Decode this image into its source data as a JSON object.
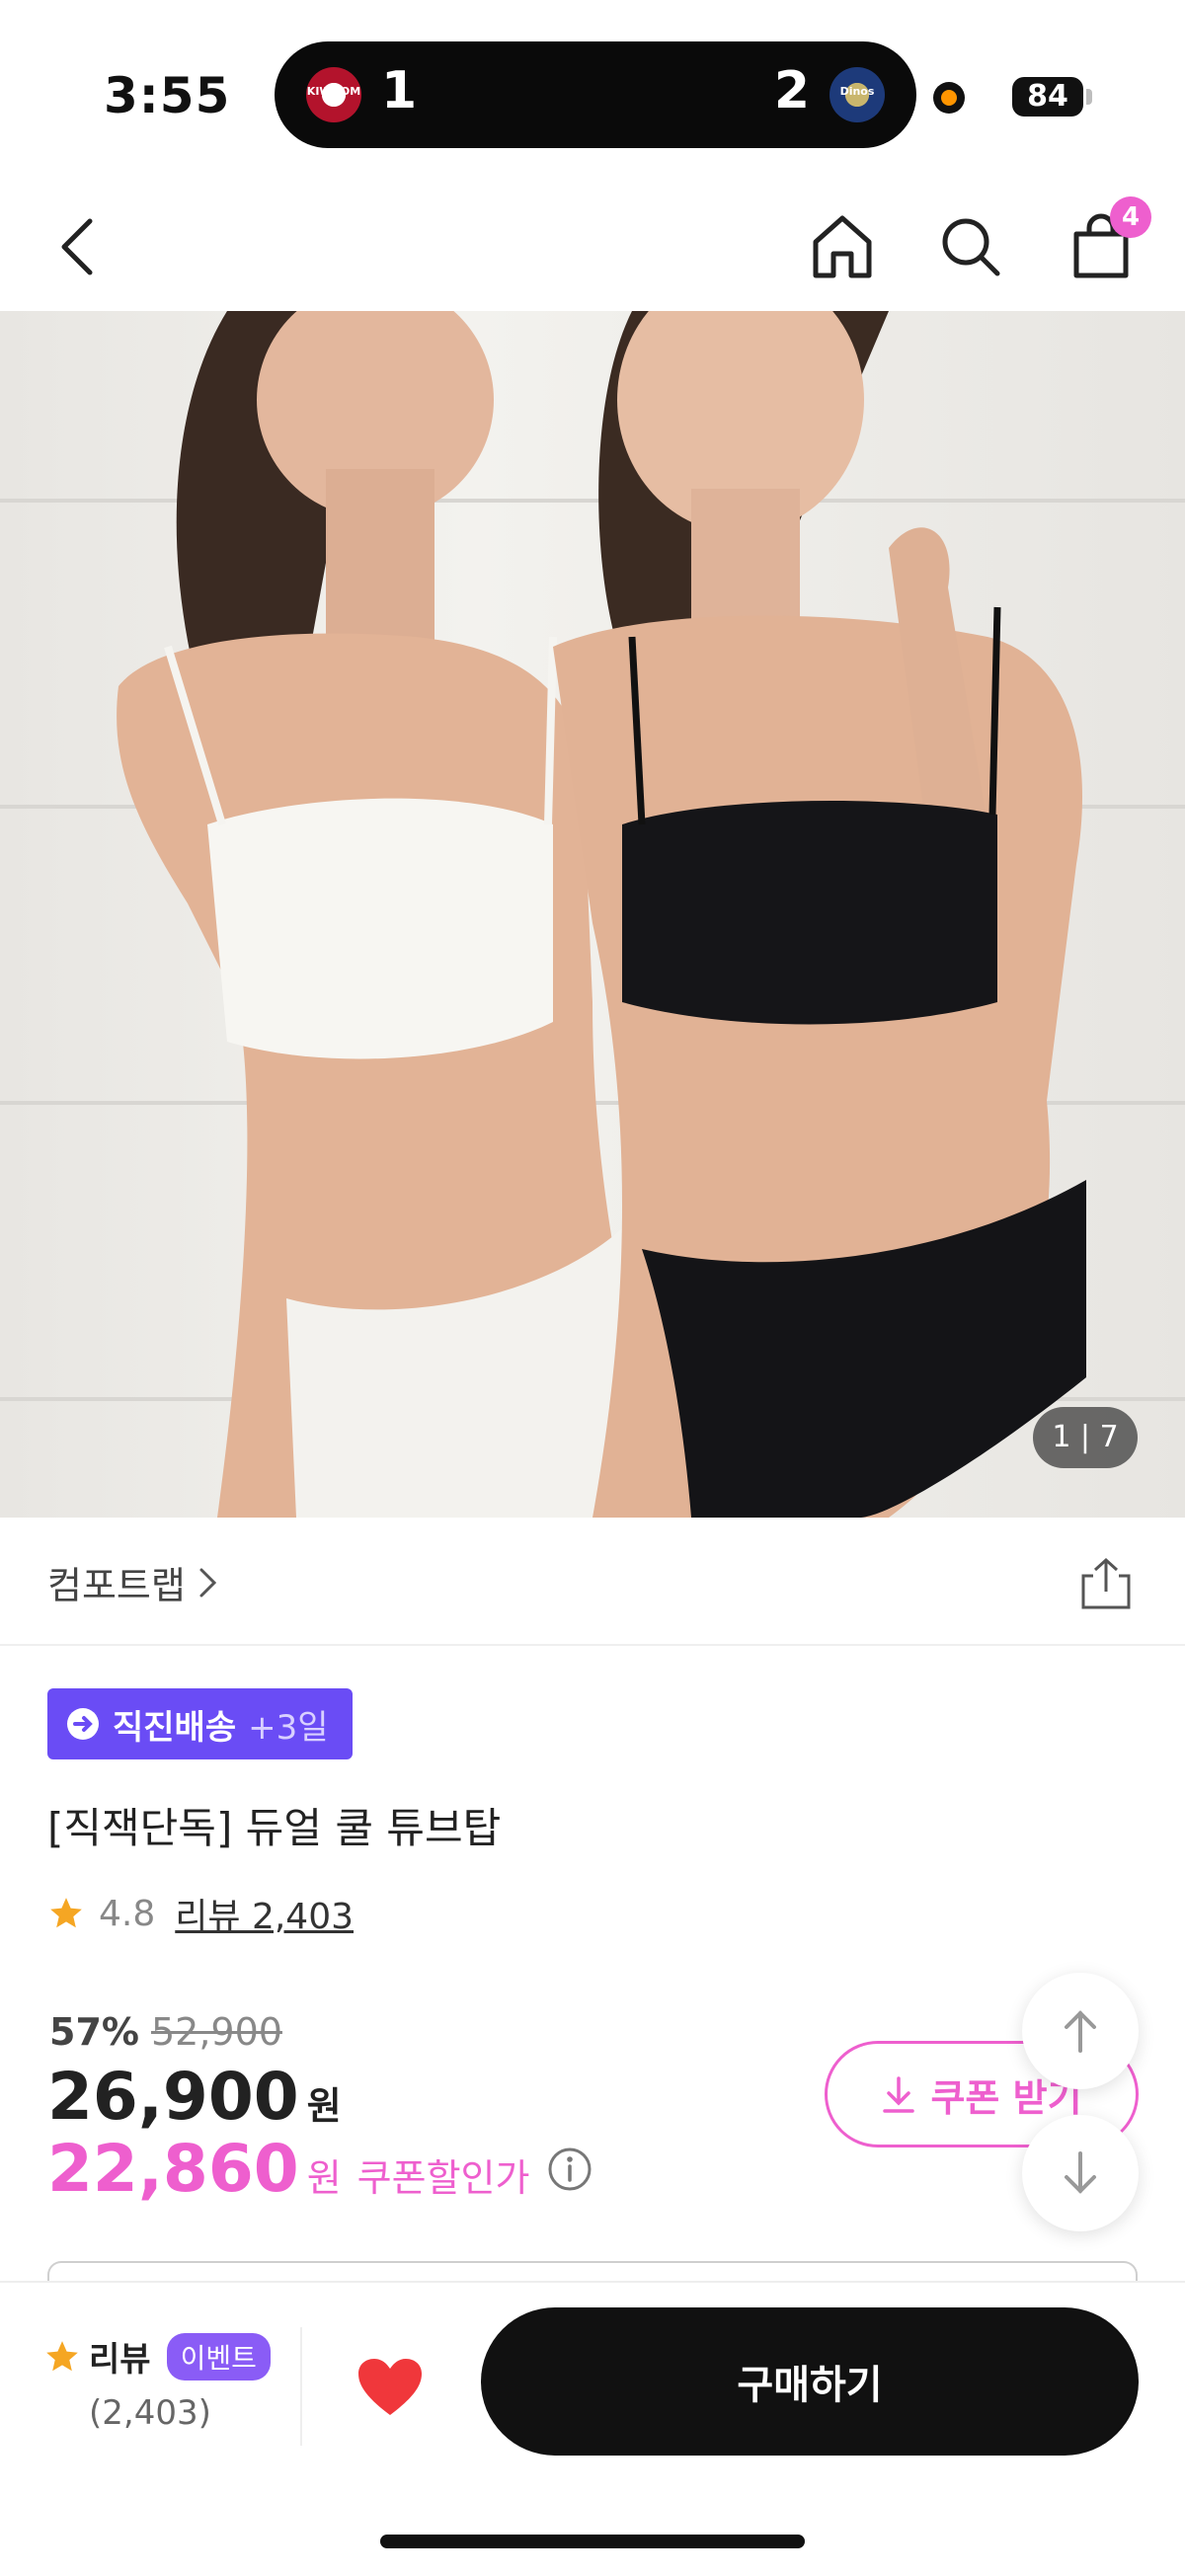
{
  "status_bar": {
    "time": "3:55",
    "home_team_logo_text": "KIWOOM",
    "home_score": "1",
    "away_score": "2",
    "away_team_logo_text": "Dinos",
    "battery": "84"
  },
  "top_nav": {
    "cart_count": "4",
    "icons": [
      "back-arrow-icon",
      "home-icon",
      "search-icon",
      "shopping-bag-icon"
    ]
  },
  "hero": {
    "page_indicator": "1 | 7",
    "current_page": 1,
    "total_pages": 7
  },
  "brand": {
    "name": "컴포트랩",
    "chevron": "›"
  },
  "product": {
    "delivery_title": "직진배송",
    "delivery_extra": "+3일",
    "name": "[직잭단독] 듀얼 쿨 튜브탑",
    "rating": "4.8",
    "review_link": "리뷰 2,403",
    "discount_rate": "57%",
    "original_price": "52,900",
    "sale_price": "26,900",
    "sale_unit": "원",
    "coupon_price": "22,860",
    "coupon_unit": "원",
    "coupon_label": "쿠폰할인가",
    "coupon_button": "쿠폰 받기"
  },
  "bottom_bar": {
    "review_label": "리뷰",
    "event_badge": "이벤트",
    "review_count": "(2,403)",
    "buy_button": "구매하기"
  },
  "colors": {
    "accent_pink": "#ee5fce",
    "delivery_purple": "#6a4cf5",
    "event_purple": "#8a5cf6",
    "wish_red": "#f0373b",
    "star": "#f5a623"
  }
}
